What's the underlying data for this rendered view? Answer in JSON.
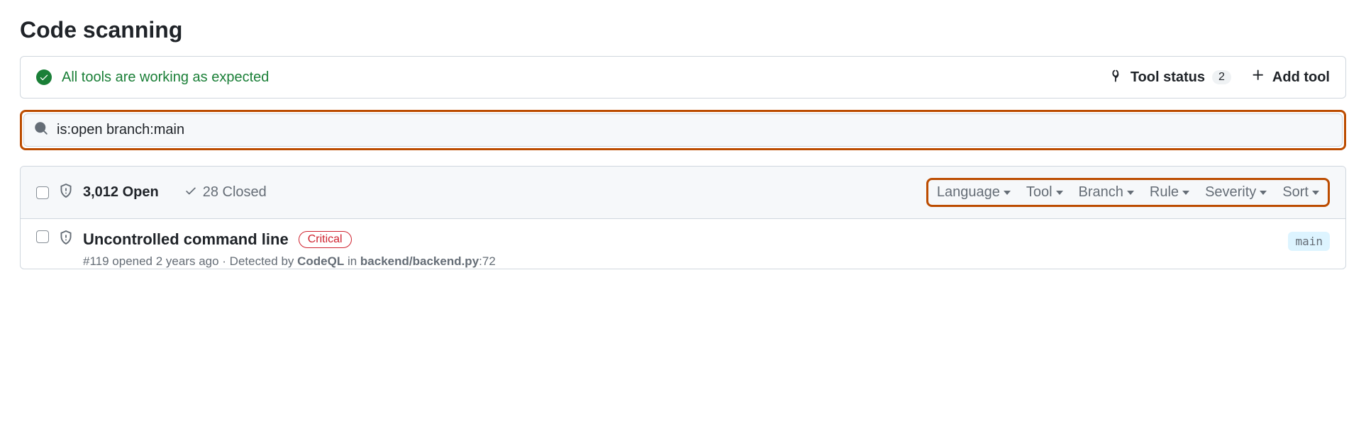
{
  "page": {
    "title": "Code scanning"
  },
  "status": {
    "message": "All tools are working as expected",
    "tool_status_label": "Tool status",
    "tool_count": "2",
    "add_tool_label": "Add tool"
  },
  "search": {
    "value": "is:open branch:main"
  },
  "tabs": {
    "open_label": "3,012 Open",
    "closed_label": "28 Closed"
  },
  "filters": {
    "language": "Language",
    "tool": "Tool",
    "branch": "Branch",
    "rule": "Rule",
    "severity": "Severity",
    "sort": "Sort"
  },
  "alert": {
    "title": "Uncontrolled command line",
    "severity": "Critical",
    "meta_prefix": "#119 opened 2 years ago · Detected by ",
    "tool": "CodeQL",
    "meta_mid": " in ",
    "file": "backend/backend.py",
    "line": ":72",
    "branch": "main"
  }
}
